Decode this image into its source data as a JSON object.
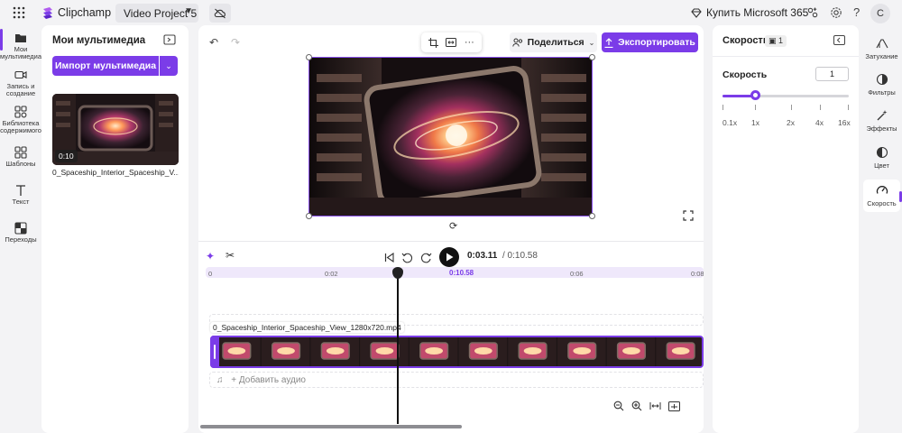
{
  "app": {
    "name": "Clipchamp",
    "project_name": "Video Project 5",
    "buy_label": "Купить Microsoft 365",
    "avatar_initial": "C",
    "help_glyph": "?"
  },
  "left_rail": {
    "items": [
      {
        "label": "Мои мультимедиа",
        "icon": "folder-icon"
      },
      {
        "label": "Запись и создание",
        "icon": "camera-icon"
      },
      {
        "label": "Библиотека содержимого",
        "icon": "library-icon"
      },
      {
        "label": "Шаблоны",
        "icon": "templates-icon"
      },
      {
        "label": "Текст",
        "icon": "text-icon"
      },
      {
        "label": "Переходы",
        "icon": "transitions-icon"
      }
    ]
  },
  "media": {
    "title": "Мои мультимедиа",
    "import_label": "Импорт мультимедиа",
    "thumb_duration": "0:10",
    "file_name": "0_Spaceship_Interior_Spaceship_V..."
  },
  "toolbar": {
    "share_label": "Поделиться",
    "export_label": "Экспортировать"
  },
  "timeline": {
    "current_time": "0:03.11",
    "total_time": "/ 0:10.58",
    "playhead_label": "0:10.58",
    "ticks": [
      "0",
      "0:02",
      "0:06",
      "0:08"
    ],
    "clip_label": "0_Spaceship_Interior_Spaceship_View_1280x720.mp4",
    "add_audio_label": "+ Добавить аудио",
    "clip_frames": 10
  },
  "speed_panel": {
    "title": "Скорость",
    "badge": "1",
    "speed_label": "Скорость",
    "speed_value": "1",
    "slider_fraction": 0.26,
    "scale_labels": [
      "0.1x",
      "1x",
      "2x",
      "4x",
      "16x"
    ]
  },
  "right_rail": {
    "items": [
      {
        "label": "Затухание",
        "icon": "fade-icon"
      },
      {
        "label": "Фильтры",
        "icon": "filters-icon"
      },
      {
        "label": "Эффекты",
        "icon": "effects-icon"
      },
      {
        "label": "Цвет",
        "icon": "color-icon"
      },
      {
        "label": "Скорость",
        "icon": "speed-icon"
      }
    ]
  },
  "colors": {
    "accent": "#7b3ce8",
    "bg": "#f3f3f5"
  }
}
